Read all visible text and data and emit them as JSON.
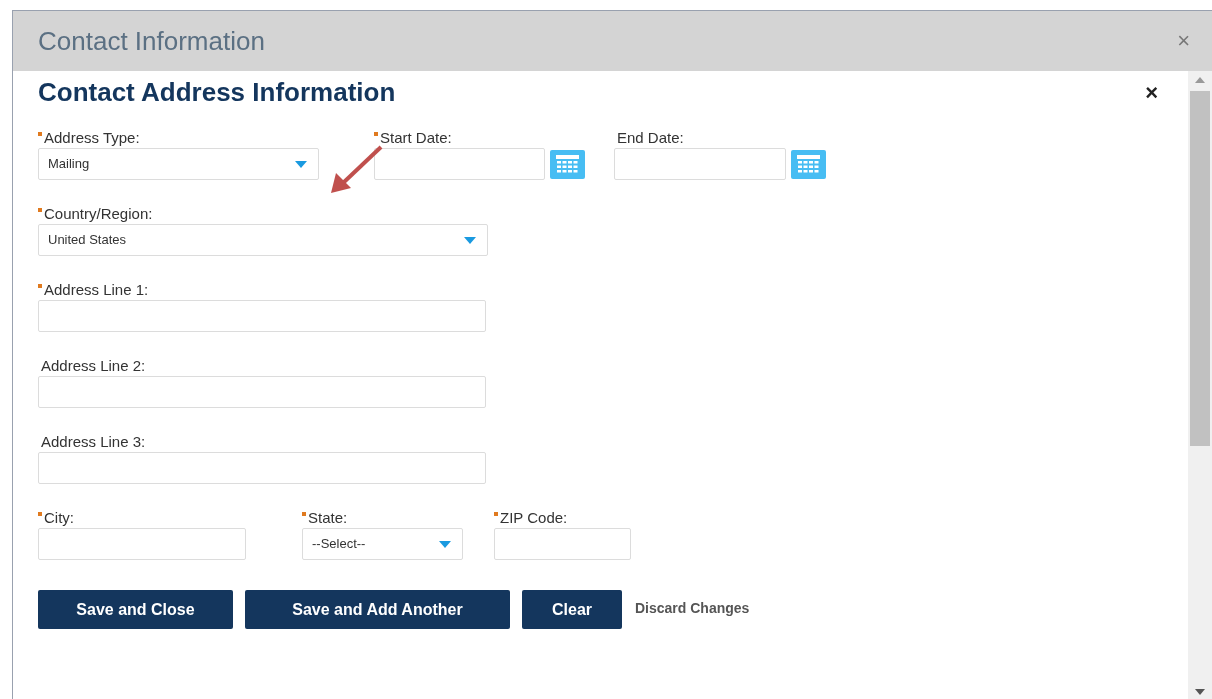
{
  "window": {
    "title": "Contact Information",
    "close": "×"
  },
  "form": {
    "title": "Contact Address Information",
    "close": "×",
    "rows": [
      [
        {
          "kind": "select",
          "label": "Address Type:",
          "required": true,
          "value": "Mailing"
        },
        {
          "kind": "date",
          "label": "Start Date:",
          "required": true
        },
        {
          "kind": "date",
          "label": "End Date:",
          "required": false
        }
      ],
      [
        {
          "kind": "select",
          "label": "Country/Region:",
          "required": true,
          "value": "United States"
        }
      ],
      [
        {
          "kind": "text",
          "label": "Address Line 1:",
          "required": true
        }
      ],
      [
        {
          "kind": "text",
          "label": "Address Line 2:",
          "required": false
        }
      ],
      [
        {
          "kind": "text",
          "label": "Address Line 3:",
          "required": false
        }
      ],
      [
        {
          "kind": "text",
          "label": "City:",
          "required": true
        },
        {
          "kind": "select",
          "label": "State:",
          "required": true,
          "value": "--Select--"
        },
        {
          "kind": "text",
          "label": "ZIP Code:",
          "required": true
        }
      ]
    ],
    "buttons": [
      {
        "kind": "primary",
        "label": "Save and Close"
      },
      {
        "kind": "primary",
        "label": "Save and Add Another"
      },
      {
        "kind": "primary",
        "label": "Clear"
      },
      {
        "kind": "link",
        "label": "Discard Changes"
      }
    ]
  }
}
